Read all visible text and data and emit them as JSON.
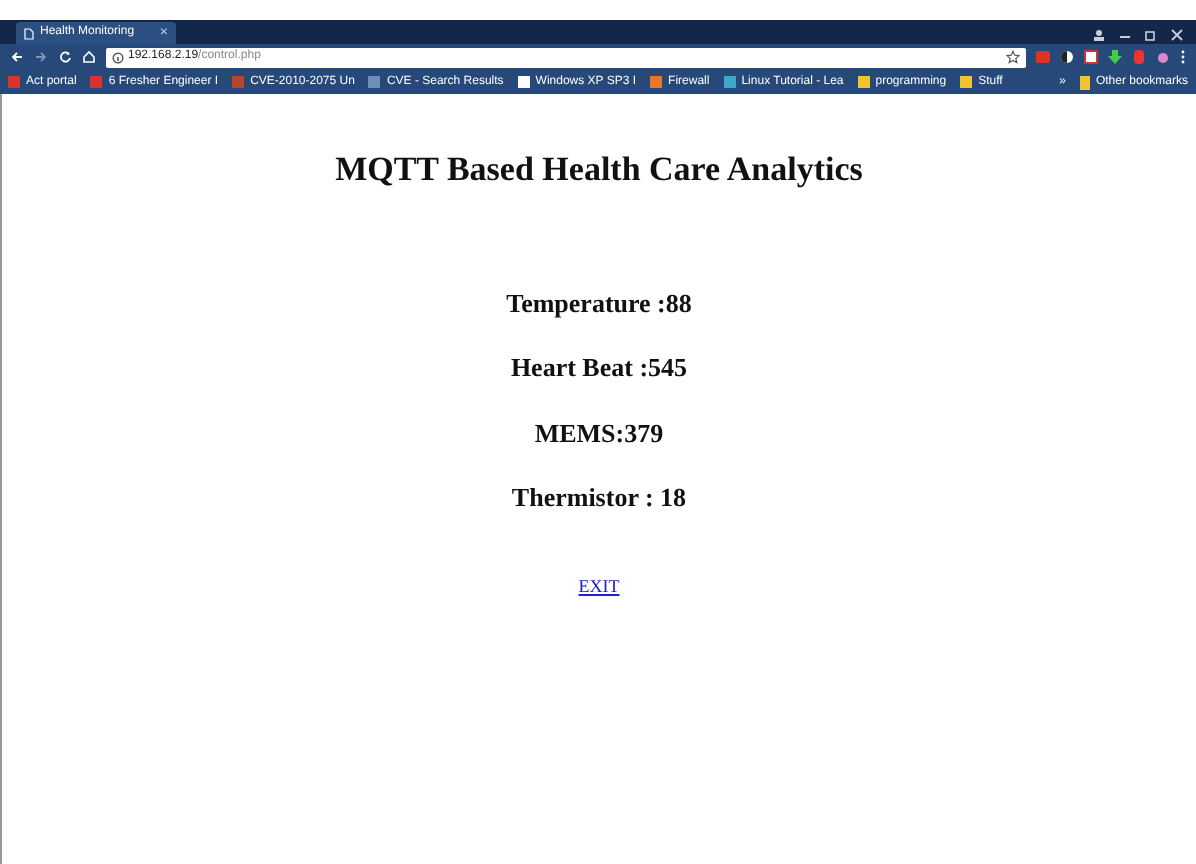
{
  "window": {
    "tab_title": "Health Monitoring",
    "tab_close": "×"
  },
  "address_bar": {
    "host": "192.168.2.19",
    "path": "/control.php"
  },
  "bookmarks": [
    {
      "label": "Act portal"
    },
    {
      "label": "6 Fresher Engineer I"
    },
    {
      "label": "CVE-2010-2075 Un"
    },
    {
      "label": "CVE - Search Results"
    },
    {
      "label": "Windows XP SP3 I"
    },
    {
      "label": "Firewall"
    },
    {
      "label": "Linux Tutorial - Lea"
    },
    {
      "label": "programming"
    },
    {
      "label": "Stuff"
    }
  ],
  "bookmarks_more": "»",
  "other_bookmarks": "Other bookmarks",
  "page": {
    "title": "MQTT Based Health Care Analytics",
    "readings": [
      "Temperature :88",
      "Heart Beat :545",
      "MEMS:379",
      "Thermistor : 18"
    ],
    "link": "EXIT"
  }
}
